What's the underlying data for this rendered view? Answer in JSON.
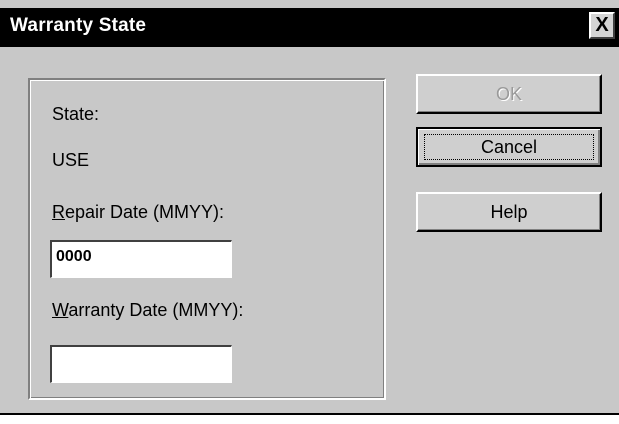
{
  "window": {
    "title": "Warranty State",
    "close_label": "X"
  },
  "form": {
    "state_label": "State:",
    "state_value": "USE",
    "repair_date_label_accel": "R",
    "repair_date_label_rest": "epair Date (MMYY):",
    "repair_date_value": "0000",
    "warranty_date_label_accel": "W",
    "warranty_date_label_rest": "arranty Date (MMYY):",
    "warranty_date_value": ""
  },
  "buttons": {
    "ok_label": "OK",
    "cancel_label": "Cancel",
    "help_label": "Help"
  },
  "colors": {
    "titlebar": "#000000",
    "dialog_face": "#c8c8c8",
    "disabled_text": "#9a9a9a"
  }
}
